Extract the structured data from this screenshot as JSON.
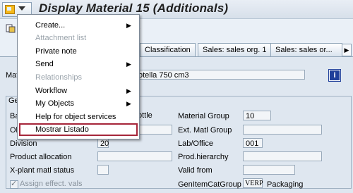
{
  "window": {
    "title": "Display Material 15 (Additionals)"
  },
  "toolbar": {
    "partial_text": "s"
  },
  "tabs": [
    {
      "label": "Classification"
    },
    {
      "label": "Sales: sales org. 1"
    },
    {
      "label": "Sales: sales or..."
    }
  ],
  "material": {
    "label": "Mat",
    "description": "otella 750 cm3"
  },
  "group": {
    "title": "Gen"
  },
  "fields": {
    "base_unit_label": "Ba",
    "base_unit_value": "ottle",
    "old_matl_label": "Ol",
    "division_label": "Division",
    "division_value": "20",
    "product_allocation_label": "Product allocation",
    "xplant_status_label": "X-plant matl status",
    "assign_effect_label": "Assign effect. vals",
    "material_group_label": "Material Group",
    "material_group_value": "10",
    "ext_matl_group_label": "Ext. Matl Group",
    "lab_office_label": "Lab/Office",
    "lab_office_value": "001",
    "prod_hierarchy_label": "Prod.hierarchy",
    "valid_from_label": "Valid from",
    "gen_item_cat_label": "GenItemCatGroup",
    "gen_item_cat_value": "VERP",
    "gen_item_cat_text": "Packaging"
  },
  "menu": {
    "items": [
      {
        "label": "Create...",
        "submenu": true,
        "disabled": false
      },
      {
        "label": "Attachment list",
        "submenu": false,
        "disabled": true
      },
      {
        "label": "Private note",
        "submenu": false,
        "disabled": false
      },
      {
        "label": "Send",
        "submenu": true,
        "disabled": false
      },
      {
        "label": "Relationships",
        "submenu": false,
        "disabled": true
      },
      {
        "label": "Workflow",
        "submenu": true,
        "disabled": false
      },
      {
        "label": "My Objects",
        "submenu": true,
        "disabled": false
      },
      {
        "label": "Help for object services",
        "submenu": false,
        "disabled": false
      },
      {
        "label": "Mostrar Listado",
        "submenu": false,
        "disabled": false
      }
    ]
  }
}
